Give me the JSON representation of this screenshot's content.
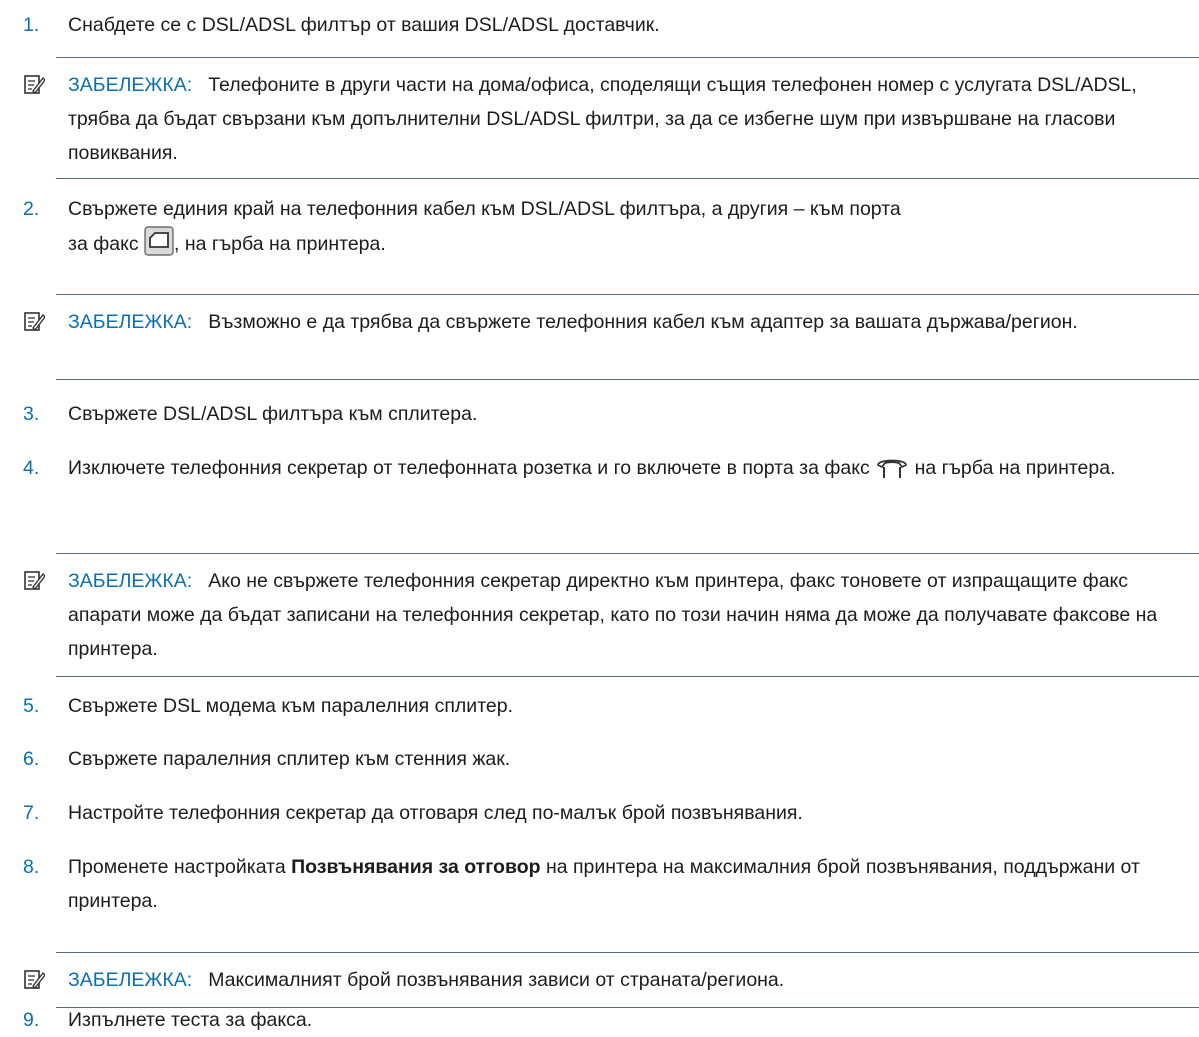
{
  "steps": [
    {
      "number": "1.",
      "text": "Снабдете се с DSL/ADSL филтър от вашия DSL/ADSL доставчик."
    },
    {
      "number": "2.",
      "text_before_icon": "Свържете единия край на телефонния кабел към DSL/ADSL филтъра, а другия – към порта за факс",
      "text_after_icon": ", на гърба на принтера.",
      "icon": "fax-port-icon"
    },
    {
      "number": "3.",
      "text": "Свържете DSL/ADSL филтъра към сплитера."
    },
    {
      "number": "4.",
      "text_before_icon": "Изключете телефонния секретар от телефонната розетка и го включете в порта за факс",
      "text_after_icon": "на гърба на принтера.",
      "icon": "phone-port-icon"
    },
    {
      "number": "5.",
      "text": "Свържете DSL модема към паралелния сплитер."
    },
    {
      "number": "6.",
      "text": "Свържете паралелния сплитер към стенния жак."
    },
    {
      "number": "7.",
      "text": "Настройте телефонния секретар да отговаря след по-малък брой позвънявания."
    },
    {
      "number": "8.",
      "text_before_bold": "Променете настройката",
      "bold": "Позвънявания за отговор",
      "text_after_bold": "на принтера на максималния брой позвънявания, поддържани от принтера."
    },
    {
      "number": "9.",
      "text": "Изпълнете теста за факса."
    }
  ],
  "notes": [
    {
      "label": "ЗАБЕЛЕЖКА:",
      "text": "Телефоните в други части на дома/офиса, споделящи същия телефонен номер с услугата DSL/ADSL, трябва да бъдат свързани към допълнителни DSL/ADSL филтри, за да се избегне шум при извършване на гласови повиквания."
    },
    {
      "label": "ЗАБЕЛЕЖКА:",
      "text": "Възможно е да трябва да свържете телефонния кабел към адаптер за вашата държава/регион."
    },
    {
      "label": "ЗАБЕЛЕЖКА:",
      "text": "Ако не свържете телефонния секретар директно към принтера, факс тоновете от изпращащите факс апарати може да бъдат записани на телефонния секретар, като по този начин няма да може да получавате факсове на принтера."
    },
    {
      "label": "ЗАБЕЛЕЖКА:",
      "text": "Максималният брой позвънявания зависи от страната/региона."
    }
  ],
  "colors": {
    "accent": "#0b6fb0",
    "text": "#1c1c1c",
    "rule": "#5a6a80"
  }
}
